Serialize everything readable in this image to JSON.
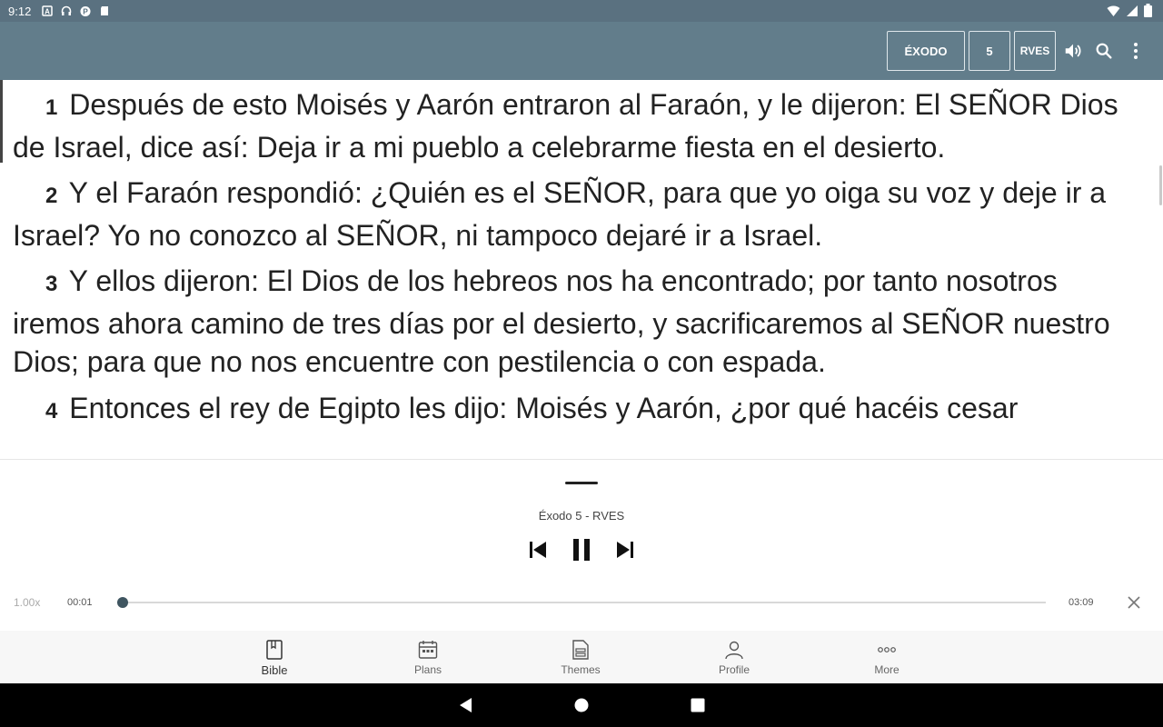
{
  "status_bar": {
    "time": "9:12",
    "left_icons": [
      "notification-a-icon",
      "headphones-icon",
      "pandora-icon",
      "sd-card-icon"
    ],
    "right_icons": [
      "wifi-icon",
      "signal-icon",
      "battery-icon"
    ]
  },
  "app_bar": {
    "book": "ÉXODO",
    "chapter": "5",
    "version": "RVES",
    "icons": [
      "volume-icon",
      "search-icon",
      "overflow-menu-icon"
    ]
  },
  "verses": [
    {
      "number": "1",
      "text": "Después de esto Moisés y Aarón entraron al Faraón, y le dijeron: El SEÑOR Dios de Israel, dice así: Deja ir a mi pueblo a celebrarme fiesta en el desierto."
    },
    {
      "number": "2",
      "text": "Y el Faraón respondió: ¿Quién es el SEÑOR, para que yo oiga su voz y deje ir a Israel? Yo no conozco al SEÑOR, ni tampoco dejaré ir a Israel."
    },
    {
      "number": "3",
      "text": "Y ellos dijeron: El Dios de los hebreos nos ha encontrado; por tanto nosotros iremos ahora camino de tres días por el desierto, y sacrificaremos al SEÑOR nuestro Dios; para que no nos encuentre con pestilencia o con espada."
    },
    {
      "number": "4",
      "text": "Entonces el rey de Egipto les dijo: Moisés y Aarón, ¿por qué hacéis cesar"
    }
  ],
  "player": {
    "title": "Éxodo 5 - RVES",
    "speed": "1.00x",
    "elapsed": "00:01",
    "total": "03:09",
    "progress_fraction": 0.0053,
    "controls": [
      "skip-previous-icon",
      "pause-icon",
      "skip-next-icon",
      "close-icon"
    ]
  },
  "bottom_nav": {
    "items": [
      {
        "label": "Bible",
        "icon": "book-icon",
        "active": true
      },
      {
        "label": "Plans",
        "icon": "calendar-icon",
        "active": false
      },
      {
        "label": "Themes",
        "icon": "document-icon",
        "active": false
      },
      {
        "label": "Profile",
        "icon": "person-icon",
        "active": false
      },
      {
        "label": "More",
        "icon": "more-dots-icon",
        "active": false
      }
    ]
  },
  "system_nav": [
    "back-icon",
    "home-icon",
    "recents-icon"
  ]
}
